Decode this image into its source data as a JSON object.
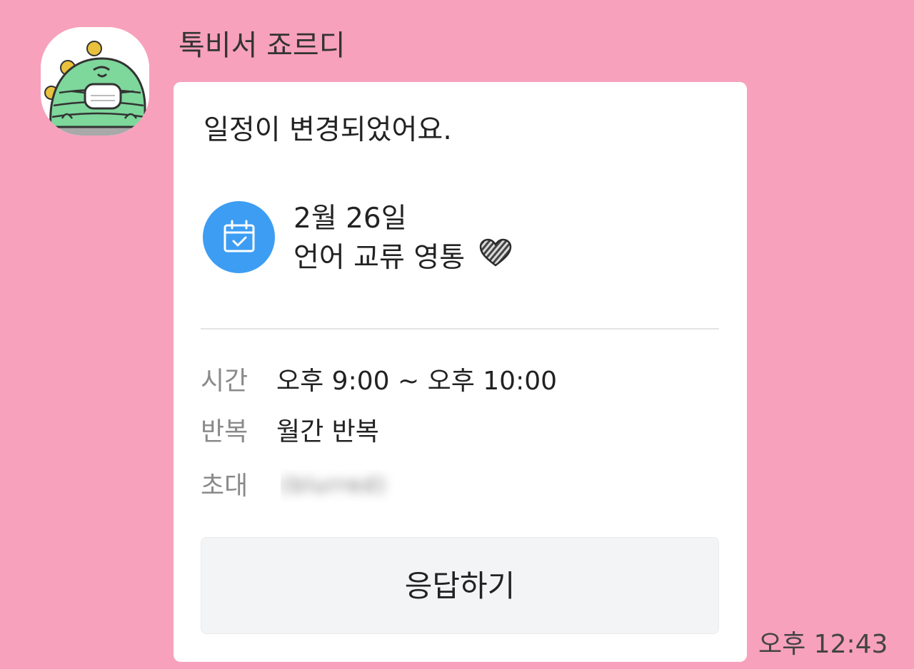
{
  "chat": {
    "sender_name": "톡비서 죠르디",
    "avatar_icon": "jordy-character-avatar",
    "timestamp": "오후 12:43",
    "background_color": "#f7a1bd"
  },
  "card": {
    "headline": "일정이 변경되었어요.",
    "calendar_icon": "calendar-check-icon",
    "accent_color": "#3d9df3",
    "event_date": "2월 26일",
    "event_title": "언어 교류 영통",
    "heart_icon": "striped-heart-icon",
    "details": {
      "time_label": "시간",
      "time_value": "오후 9:00 ~ 오후 10:00",
      "repeat_label": "반복",
      "repeat_value": "월간 반복",
      "invite_label": "초대",
      "invite_value": "(blurred)"
    },
    "respond_button_label": "응답하기"
  }
}
